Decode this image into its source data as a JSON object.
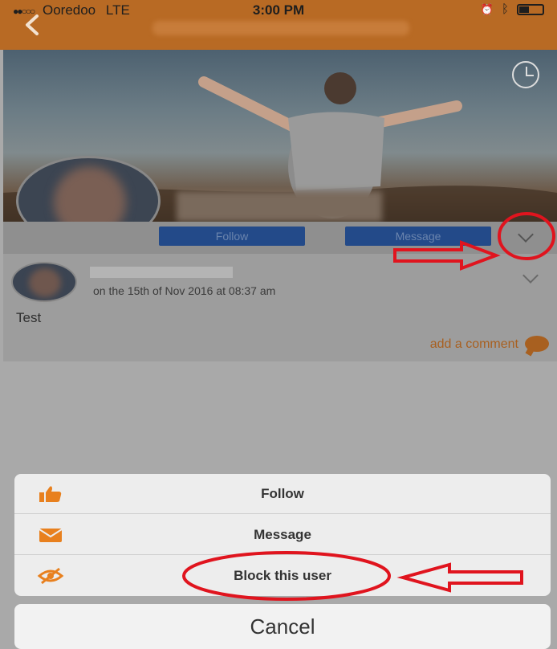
{
  "status_bar": {
    "carrier": "Ooredoo",
    "network": "LTE",
    "time": "3:00 PM"
  },
  "profile": {
    "follow_label": "Follow",
    "message_label": "Message"
  },
  "post": {
    "date": "on the 15th of Nov 2016 at 08:37 am",
    "text": "Test",
    "add_comment": "add a comment"
  },
  "action_sheet": {
    "items": [
      {
        "label": "Follow",
        "icon": "thumbs-up-icon"
      },
      {
        "label": "Message",
        "icon": "envelope-icon"
      },
      {
        "label": "Block this user",
        "icon": "eye-slash-icon"
      }
    ],
    "cancel_label": "Cancel"
  },
  "colors": {
    "brand_orange": "#b86a24",
    "button_blue": "#234a89",
    "icon_orange": "#e8801e",
    "annotation_red": "#e0141e"
  }
}
